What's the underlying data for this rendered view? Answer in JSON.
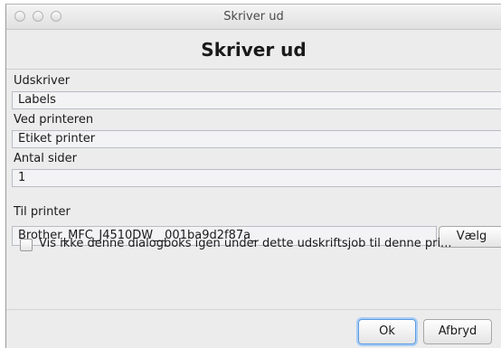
{
  "window": {
    "title": "Skriver ud"
  },
  "dialog": {
    "heading": "Skriver ud",
    "fields": [
      {
        "label": "Udskriver",
        "value": "Labels"
      },
      {
        "label": "Ved printeren",
        "value": "Etiket printer"
      },
      {
        "label": "Antal sider",
        "value": "1"
      }
    ],
    "printer": {
      "label": "Til printer",
      "value": "Brother_MFC_J4510DW__001ba9d2f87a_",
      "choose_label": "Vælg"
    },
    "checkbox": {
      "label": "Vis ikke denne dialogboks igen under dette udskriftsjob til denne pri...",
      "checked": false
    },
    "buttons": {
      "ok": "Ok",
      "cancel": "Afbryd"
    }
  }
}
